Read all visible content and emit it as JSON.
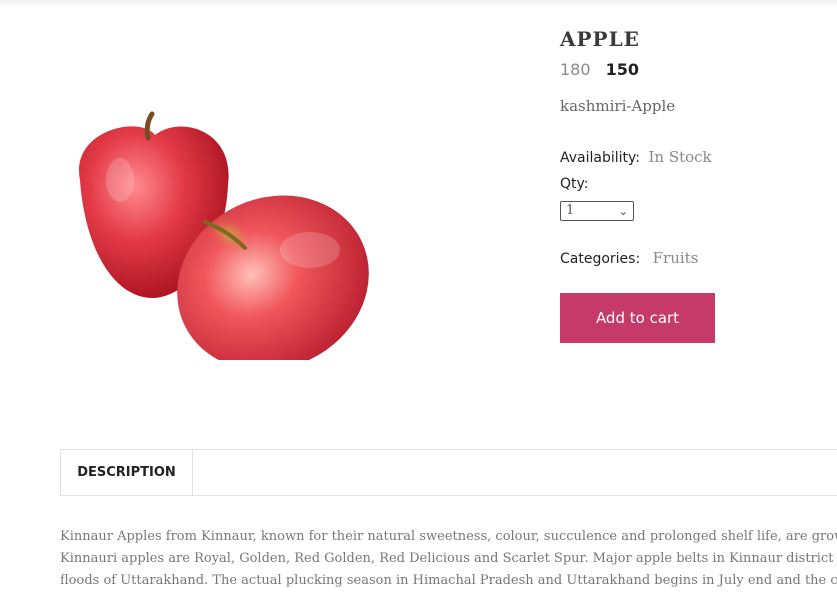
{
  "product": {
    "title": "APPLE",
    "price_old": "180",
    "price_new": "150",
    "subtitle": "kashmiri-Apple",
    "availability_label": "Availability:",
    "availability_value": "In Stock",
    "qty_label": "Qty:",
    "qty_value": "1",
    "categories_label": "Categories:",
    "categories_value": "Fruits",
    "add_to_cart_label": "Add to cart",
    "accent_color": "#c53a68"
  },
  "tabs": [
    {
      "label": "DESCRIPTION"
    }
  ],
  "description": {
    "lines": [
      "Kinnaur Apples from Kinnaur, known for their natural sweetness, colour, succulence and prolonged shelf life, are grown at an alt",
      "Kinnauri apples are Royal, Golden, Red Golden, Red Delicious and Scarlet Spur. Major apple belts in Kinnaur district are in Sang",
      "floods of Uttarakhand. The actual plucking season in Himachal Pradesh and Uttarakhand begins in July end and the crop hits the"
    ]
  }
}
